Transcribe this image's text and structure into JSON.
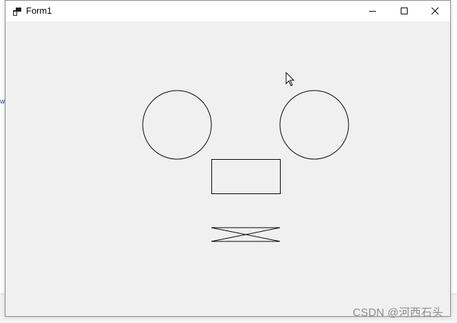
{
  "window": {
    "title": "Form1",
    "icons": {
      "app": "app-window-icon",
      "minimize": "minimize-icon",
      "maximize": "maximize-icon",
      "close": "close-icon"
    }
  },
  "background": {
    "left_glyph": "w"
  },
  "canvas": {
    "shapes": [
      "left-circle",
      "right-circle",
      "rectangle",
      "hourglass-crossed-lines"
    ],
    "stroke_color": "#000000",
    "background_color": "#f0f0f0"
  },
  "watermark": {
    "text": "CSDN @河西石头"
  },
  "colors": {
    "titlebar": "#ffffff",
    "window_border": "#8a8a8a"
  }
}
